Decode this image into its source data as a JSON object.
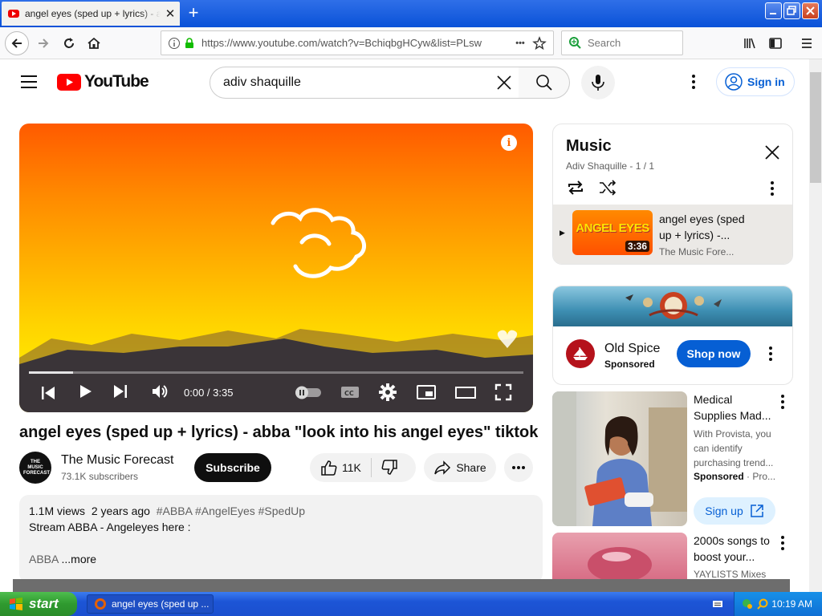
{
  "browser": {
    "tab_title": "angel eyes (sped up + lyrics) - abba",
    "url": "https://www.youtube.com/watch?v=BchiqbgHCyw&list=PLsw",
    "url_more": "•••",
    "search_placeholder": "Search"
  },
  "youtube": {
    "logo_text": "YouTube",
    "search_value": "adiv shaquille",
    "sign_in": "Sign in",
    "player": {
      "time": "0:00 / 3:35",
      "progress_fraction": 0.09
    },
    "video": {
      "title": "angel eyes (sped up + lyrics) - abba \"look into his angel eyes\" tiktok",
      "channel_name": "The Music Forecast",
      "channel_avatar_text": "THE MUSIC FORECAST",
      "subscribers": "73.1K subscribers",
      "subscribe": "Subscribe",
      "likes": "11K",
      "share": "Share",
      "views": "1.1M views",
      "age": "2 years ago",
      "tags": "#ABBA #AngelEyes #SpedUp",
      "desc_line1": "Stream ABBA - Angeleyes here :",
      "desc_line2": "ABBA",
      "more": "...more"
    },
    "playlist": {
      "title": "Music",
      "subtitle": "Adiv Shaquille - 1 / 1",
      "item_title": "angel eyes (sped up + lyrics) -...",
      "item_channel": "The Music Fore...",
      "item_duration": "3:36",
      "thumb_text": "ANGEL EYES"
    },
    "ad": {
      "brand": "Old Spice",
      "sponsored": "Sponsored",
      "cta": "Shop now"
    },
    "sidebar_videos": [
      {
        "title": "Medical Supplies Mad...",
        "desc": "With Provista, you can identify purchasing trend...",
        "meta": "Sponsored",
        "meta2": "· Pro...",
        "cta": "Sign up"
      },
      {
        "title": "2000s songs to boost your...",
        "meta": "YAYLISTS Mixes"
      }
    ]
  },
  "taskbar": {
    "start": "start",
    "task_label": "angel eyes (sped up ...",
    "clock": "10:19 AM"
  },
  "colors": {
    "yt_red": "#ff0000",
    "link_blue": "#065fd4",
    "xp_blue": "#245edb",
    "xp_green": "#3a9a3a"
  }
}
